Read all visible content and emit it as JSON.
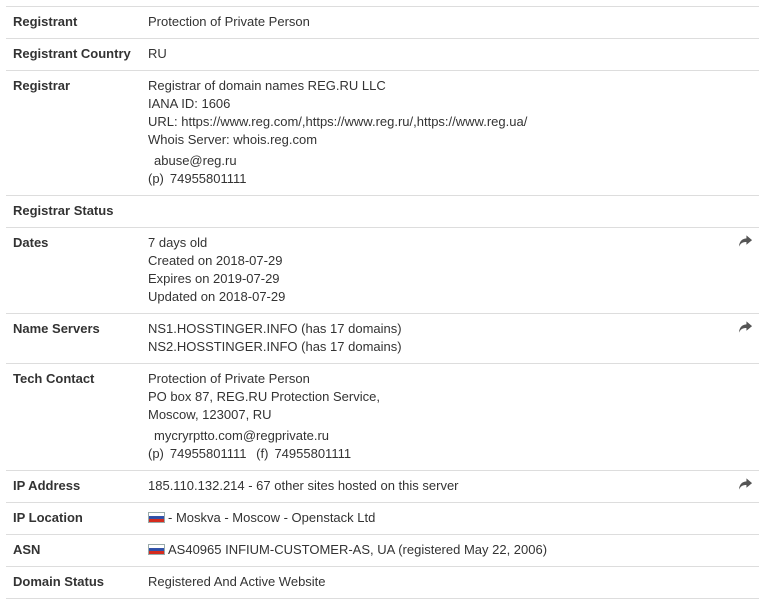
{
  "rows": {
    "registrant": {
      "label": "Registrant",
      "value": "Protection of Private Person"
    },
    "registrant_country": {
      "label": "Registrant Country",
      "value": "RU"
    },
    "registrar": {
      "label": "Registrar",
      "name": "Registrar of domain names REG.RU LLC",
      "iana": "IANA ID: 1606",
      "url": "URL: https://www.reg.com/,https://www.reg.ru/,https://www.reg.ua/",
      "whois": "Whois Server: whois.reg.com",
      "email": "abuse@reg.ru",
      "phone_label": "(p)",
      "phone": "74955801111"
    },
    "registrar_status": {
      "label": "Registrar Status",
      "value": ""
    },
    "dates": {
      "label": "Dates",
      "age": "7 days old",
      "created": "Created on 2018-07-29",
      "expires": "Expires on 2019-07-29",
      "updated": "Updated on 2018-07-29"
    },
    "name_servers": {
      "label": "Name Servers",
      "ns1": "NS1.HOSSTINGER.INFO (has 17 domains)",
      "ns2": "NS2.HOSSTINGER.INFO (has 17 domains)"
    },
    "tech_contact": {
      "label": "Tech Contact",
      "name": "Protection of Private Person",
      "address1": "PO box 87, REG.RU Protection Service,",
      "address2": "Moscow, 123007, RU",
      "email": "mycryrptto.com@regprivate.ru",
      "phone_label": "(p)",
      "phone": "74955801111",
      "fax_label": "(f)",
      "fax": "74955801111"
    },
    "ip_address": {
      "label": "IP Address",
      "value": "185.110.132.214 - 67 other sites hosted on this server"
    },
    "ip_location": {
      "label": "IP Location",
      "value": "- Moskva - Moscow - Openstack Ltd"
    },
    "asn": {
      "label": "ASN",
      "value": "AS40965 INFIUM-CUSTOMER-AS, UA (registered May 22, 2006)"
    },
    "domain_status": {
      "label": "Domain Status",
      "value": "Registered And Active Website"
    }
  },
  "icons": {
    "share": "share-arrow-icon",
    "flag": "russia-flag-icon"
  },
  "colors": {
    "text": "#333333",
    "border": "#dddddd",
    "icon": "#555555"
  }
}
